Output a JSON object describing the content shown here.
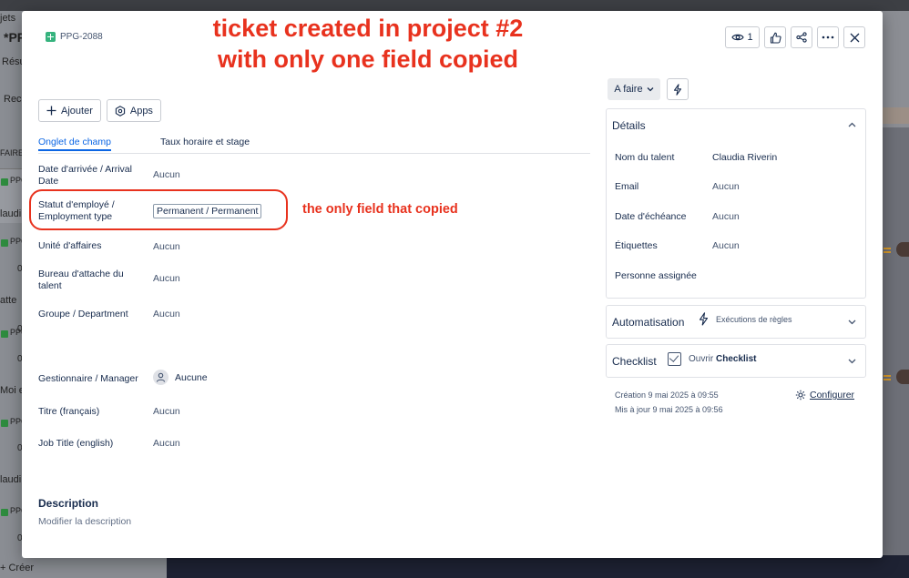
{
  "background": {
    "items": [
      "jets",
      "*PR",
      "Résu",
      "Rech",
      "FAIRE",
      "PPG",
      "laudi",
      "0",
      "PPG",
      "0",
      "atte",
      "PPG",
      "0",
      "Moi et",
      "PPG",
      "0",
      "laudi",
      "PPG",
      "0",
      "+ Créer"
    ]
  },
  "annotations": {
    "title_line1": "ticket created in project #2",
    "title_line2": "with only one field copied",
    "side_note": "the only field that copied",
    "color": "#e8321e"
  },
  "header": {
    "issue_key": "PPG-2088",
    "watch_count": "1"
  },
  "toolbar": {
    "add_label": "Ajouter",
    "apps_label": "Apps"
  },
  "tabs": [
    {
      "label": "Onglet de champ",
      "active": true
    },
    {
      "label": "Taux horaire et stage",
      "active": false
    }
  ],
  "fields": {
    "arrival": {
      "label": "Date d'arrivée / Arrival Date",
      "value": "Aucun"
    },
    "status": {
      "label": "Statut d'employé / Employment type",
      "value": "Permanent / Permanent"
    },
    "unit": {
      "label": "Unité d'affaires",
      "value": "Aucun"
    },
    "office": {
      "label": "Bureau d'attache du talent",
      "value": "Aucun"
    },
    "group": {
      "label": "Groupe / Department",
      "value": "Aucun"
    },
    "manager": {
      "label": "Gestionnaire / Manager",
      "value": "Aucune"
    },
    "title_fr": {
      "label": "Titre (français)",
      "value": "Aucun"
    },
    "job_title": {
      "label": "Job Title (english)",
      "value": "Aucun"
    }
  },
  "description": {
    "title": "Description",
    "placeholder": "Modifier la description"
  },
  "status_button": "A faire",
  "details": {
    "title": "Détails",
    "rows": [
      {
        "label": "Nom du talent",
        "value": "Claudia Riverin"
      },
      {
        "label": "Email",
        "value": "Aucun"
      },
      {
        "label": "Date d'échéance",
        "value": "Aucun"
      },
      {
        "label": "Étiquettes",
        "value": "Aucun"
      },
      {
        "label": "Personne assignée",
        "value": ""
      }
    ]
  },
  "automation": {
    "title": "Automatisation",
    "runs_label": "Exécutions de règles"
  },
  "checklist": {
    "title": "Checklist",
    "open_prefix": "Ouvrir",
    "open_name": "Checklist"
  },
  "meta": {
    "created": "Création 9 mai 2025 à 09:55",
    "updated": "Mis à jour 9 mai 2025 à 09:56",
    "configure_label": "Configurer"
  }
}
